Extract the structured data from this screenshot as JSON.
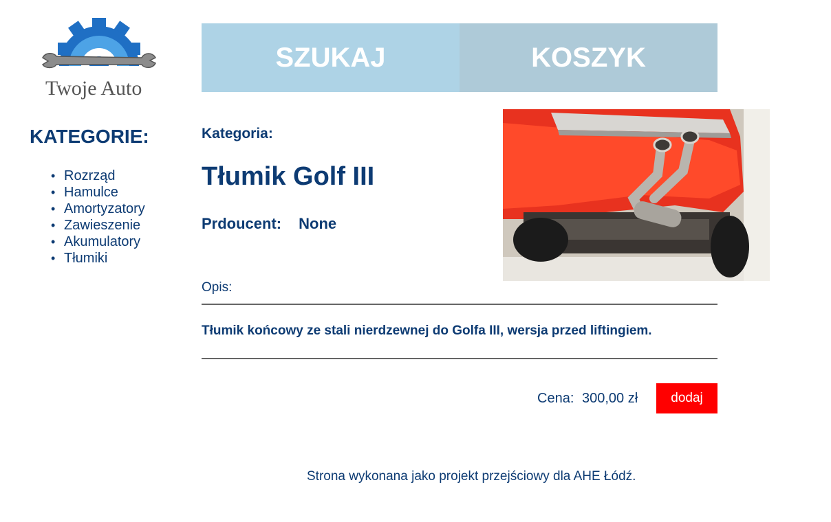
{
  "logo": {
    "text": "Twoje Auto",
    "icon": "gear-wrench-icon",
    "colors": {
      "gear": "#1f6fc4",
      "wrench": "#8c8c8c"
    }
  },
  "nav": {
    "search_label": "SZUKAJ",
    "cart_label": "KOSZYK"
  },
  "sidebar": {
    "title": "KATEGORIE:",
    "items": [
      {
        "label": "Rozrząd"
      },
      {
        "label": "Hamulce"
      },
      {
        "label": "Amortyzatory"
      },
      {
        "label": "Zawieszenie"
      },
      {
        "label": "Akumulatory"
      },
      {
        "label": "Tłumiki"
      }
    ]
  },
  "product": {
    "category_label": "Kategoria:",
    "title": "Tłumik Golf III",
    "producer_label": "Prdoucent:",
    "producer_value": "None",
    "description_label": "Opis:",
    "description": "Tłumik końcowy ze stali nierdzewnej do Golfa III, wersja przed liftingiem.",
    "price_label": "Cena:",
    "price_value": "300,00 zł",
    "add_button_label": "dodaj",
    "image": "car-exhaust-photo"
  },
  "footer": {
    "text": "Strona wykonana jako projekt przejściowy dla AHE Łódź."
  },
  "colors": {
    "primary_text": "#0d3b73",
    "nav_search_bg": "#aed3e6",
    "nav_cart_bg": "#aecad8",
    "add_button_bg": "#ff0000"
  }
}
